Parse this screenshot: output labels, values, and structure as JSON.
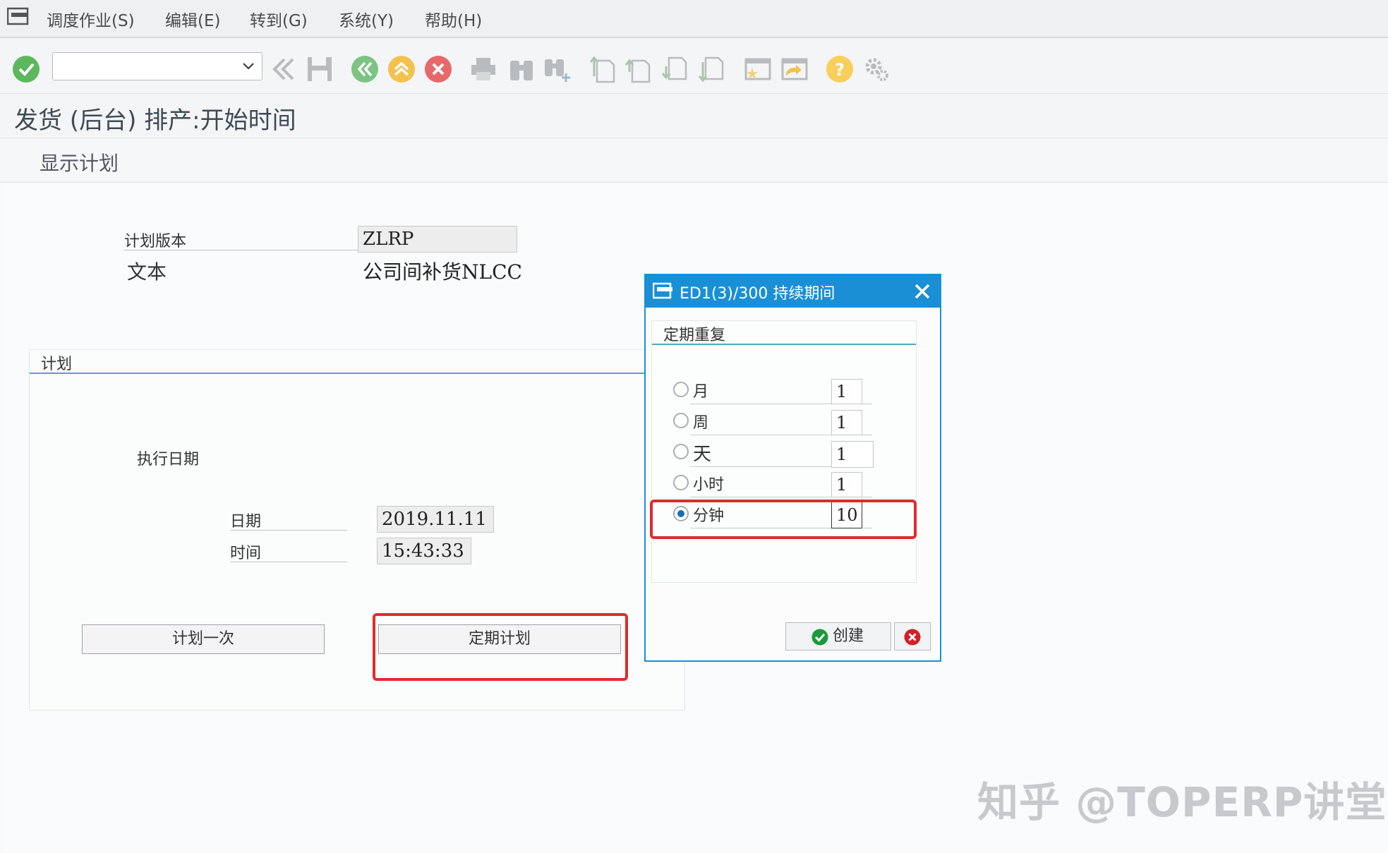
{
  "menubar": {
    "items": [
      "调度作业(S)",
      "编辑(E)",
      "转到(G)",
      "系统(Y)",
      "帮助(H)"
    ]
  },
  "toolbar": {
    "command_field_value": "",
    "icons": [
      "enter-icon",
      "back-icon",
      "save-icon",
      "back-green-icon",
      "exit-icon",
      "cancel-icon",
      "print-icon",
      "find-icon",
      "find-next-icon",
      "first-page-icon",
      "previous-page-icon",
      "next-page-icon",
      "last-page-icon",
      "create-session-icon",
      "shortcut-icon",
      "help-icon",
      "settings-icon"
    ]
  },
  "page": {
    "title": "发货 (后台) 排产:开始时间",
    "app_button": "显示计划"
  },
  "header_fields": {
    "plan_version_label": "计划版本",
    "plan_version_value": "ZLRP",
    "text_label": "文本",
    "text_value": "公司间补货NLCC"
  },
  "plan_group": {
    "title": "计划",
    "exec_date_heading": "执行日期",
    "date_label": "日期",
    "date_value": "2019.11.11",
    "time_label": "时间",
    "time_value": "15:43:33",
    "once_button": "计划一次",
    "periodic_button": "定期计划"
  },
  "dialog": {
    "title": "ED1(3)/300 持续期间",
    "group_title": "定期重复",
    "options": [
      {
        "label": "月",
        "value": "1",
        "selected": false
      },
      {
        "label": "周",
        "value": "1",
        "selected": false
      },
      {
        "label": "天",
        "value": "1",
        "selected": false
      },
      {
        "label": "小时",
        "value": "1",
        "selected": false
      },
      {
        "label": "分钟",
        "value": "10",
        "selected": true
      }
    ],
    "create_button": "创建"
  },
  "colors": {
    "dialog_header": "#1a8fd6",
    "highlight_box": "#e02b2b",
    "group_underline": "#4fa7c0"
  },
  "watermark": "知乎 @TOPERP讲堂"
}
